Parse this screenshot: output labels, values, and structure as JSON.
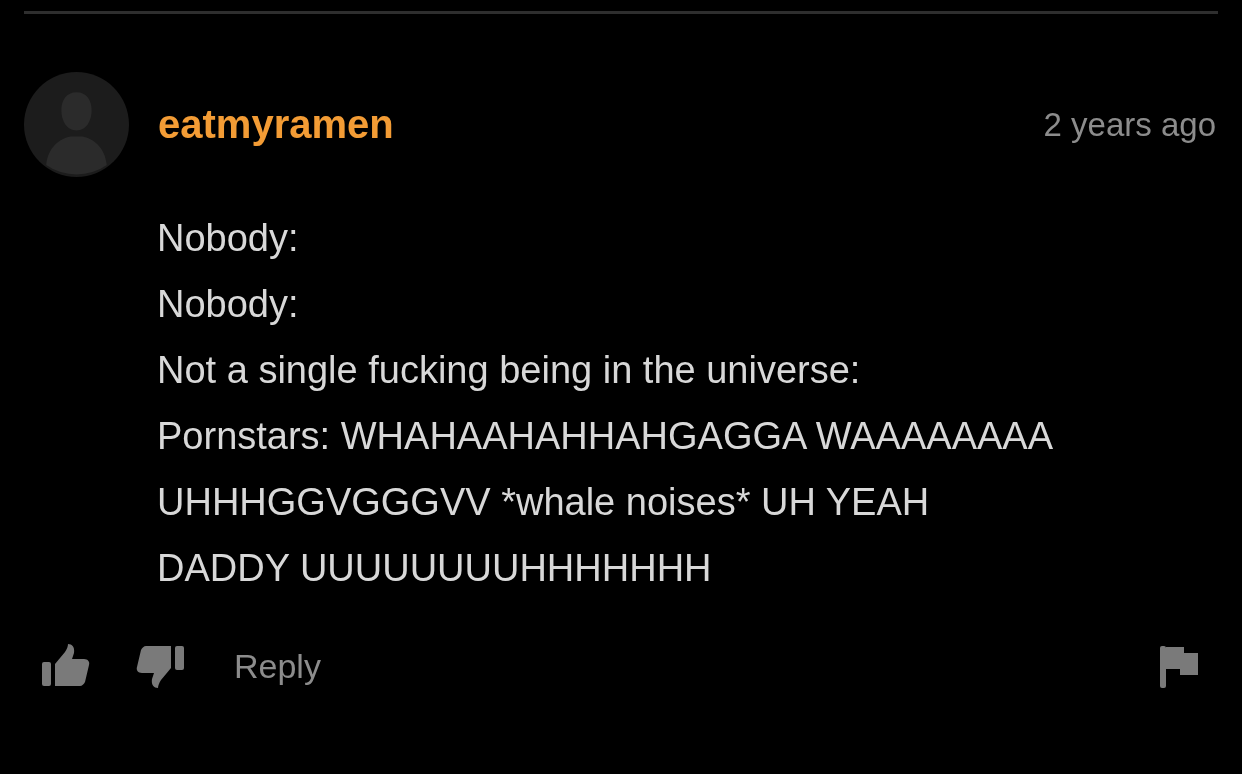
{
  "comment": {
    "username": "eatmyramen",
    "time": "2 years ago",
    "body_lines": [
      "Nobody:",
      "Nobody:",
      "Not a single fucking being in the universe:",
      "Pornstars: WHAHAAHAHHAHGAGGA WAAAAAAAA",
      "UHHHGGVGGGVV *whale noises* UH YEAH",
      "DADDY UUUUUUUUHHHHHHH"
    ],
    "reply_label": "Reply"
  }
}
